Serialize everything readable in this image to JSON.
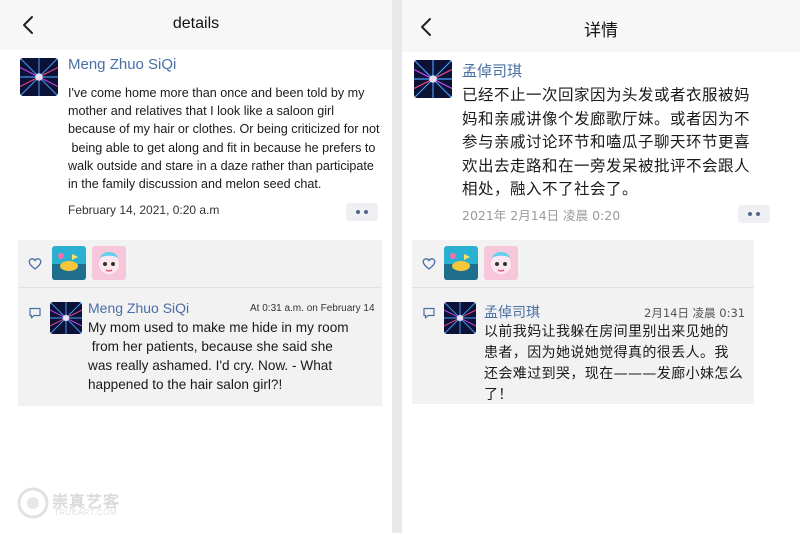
{
  "left": {
    "header": {
      "title": "details"
    },
    "post": {
      "author": "Meng Zhuo SiQi",
      "body_lines": [
        "I've come home more than once and been told by my",
        "mother and relatives that I look like a saloon girl",
        "because of my hair or clothes. Or being criticized for not",
        " being able to get along and fit in because he prefers to",
        "walk outside and stare in a daze rather than participate",
        "in the family discussion and melon seed chat."
      ],
      "time": "February 14, 2021, 0:20 a.m"
    },
    "comment": {
      "author": "Meng Zhuo SiQi",
      "time": "At 0:31 a.m. on February 14",
      "text_lines": [
        "My mom used to make me hide in my room",
        " from her patients, because she said she",
        "was really ashamed. I'd cry. Now. - What",
        "happened to the hair salon girl?!"
      ]
    }
  },
  "right": {
    "header": {
      "title": "详情"
    },
    "post": {
      "author": "孟倬司琪",
      "body_lines": [
        "已经不止一次回家因为头发或者衣服被妈",
        "妈和亲戚讲像个发廊歌厅妹。或者因为不",
        "参与亲戚讨论环节和嗑瓜子聊天环节更喜",
        "欢出去走路和在一旁发呆被批评不会跟人",
        "相处，融入不了社会了。"
      ],
      "time": "2021年 2月14日 凌晨 0:20"
    },
    "comment": {
      "author": "孟倬司琪",
      "time": "2月14日 凌晨 0:31",
      "text_lines": [
        "以前我妈让我躲在房间里别出来见她的",
        "患者，因为她说她觉得真的很丢人。我",
        "还会难过到哭，现在———发廊小妹怎么",
        "了！"
      ]
    }
  },
  "watermark": {
    "name": "崇真艺客",
    "site": "TRUEART.COM"
  },
  "colors": {
    "link_blue": "#4a6fa5",
    "panel_bg": "#f2f2f3",
    "header_bg": "#f7f7f8"
  },
  "icons": [
    "back-arrow",
    "heart",
    "comment",
    "more-dots"
  ]
}
